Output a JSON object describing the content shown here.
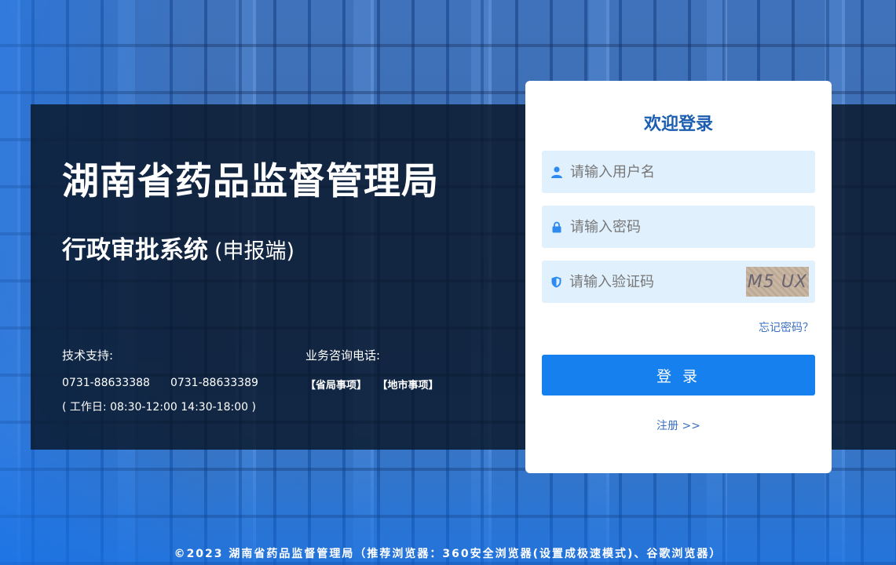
{
  "hero": {
    "title": "湖南省药品监督管理局",
    "subtitle": "行政审批系统",
    "subtitle_note": "(申报端)"
  },
  "contact": {
    "support_label": "技术支持:",
    "phone1": "0731-88633388",
    "phone2": "0731-88633389",
    "hours": "( 工作日: 08:30-12:00 14:30-18:00 )",
    "consult_label": "业务咨询电话:",
    "matter1": "【省局事项】",
    "matter2": "【地市事项】"
  },
  "login": {
    "title": "欢迎登录",
    "username_placeholder": "请输入用户名",
    "password_placeholder": "请输入密码",
    "captcha_placeholder": "请输入验证码",
    "captcha_text": "M5 UX",
    "forgot": "忘记密码？",
    "submit": "登 录",
    "register": "注册 >>"
  },
  "footer": {
    "text": "©2023 湖南省药品监督管理局（推荐浏览器：360安全浏览器(设置成极速模式)、谷歌浏览器）"
  },
  "colors": {
    "accent": "#1580ee",
    "title_blue": "#1b5db0",
    "field_bg": "#e0f0fd"
  },
  "icons": {
    "username": "user-icon",
    "password": "lock-icon",
    "captcha": "shield-icon"
  }
}
